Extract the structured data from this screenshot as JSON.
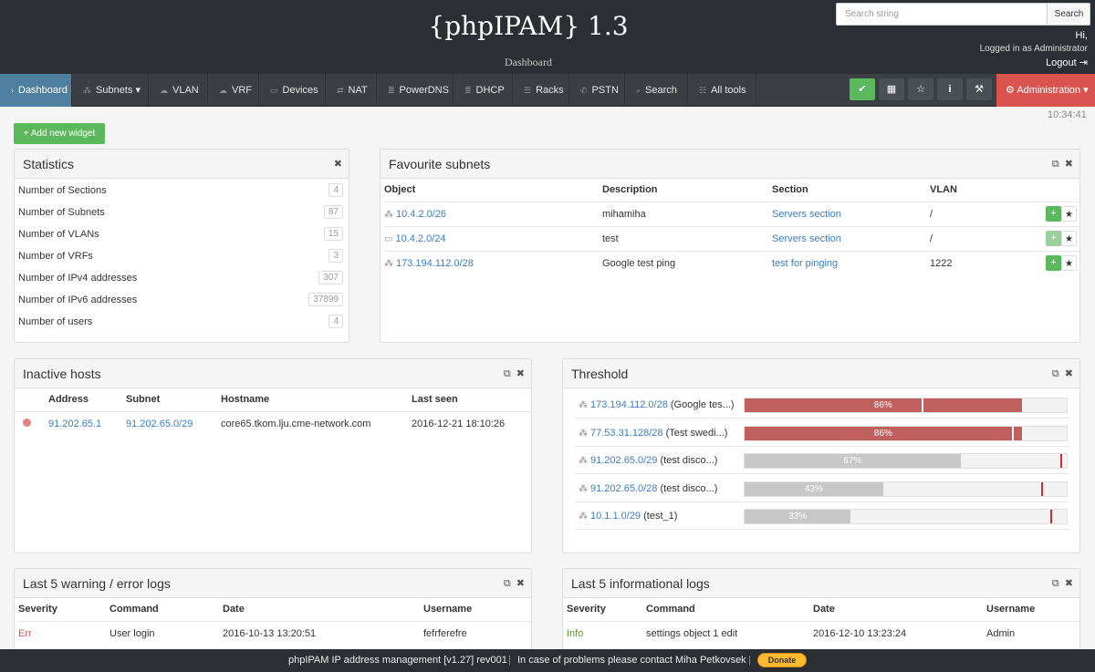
{
  "header": {
    "brand": "{phpIPAM} 1.3",
    "subtitle": "Dashboard",
    "search_placeholder": "Search string",
    "search_button": "Search",
    "greeting": "Hi,",
    "logged_in": "Logged in as Administrator",
    "logout": "Logout"
  },
  "nav": {
    "items": [
      {
        "label": "Dashboard",
        "icon": "chevron-right-icon"
      },
      {
        "label": "Subnets",
        "icon": "sitemap-icon"
      },
      {
        "label": "VLAN",
        "icon": "cloud-icon"
      },
      {
        "label": "VRF",
        "icon": "cloud-icon"
      },
      {
        "label": "Devices",
        "icon": "desktop-icon"
      },
      {
        "label": "NAT",
        "icon": "exchange-icon"
      },
      {
        "label": "PowerDNS",
        "icon": "database-icon"
      },
      {
        "label": "DHCP",
        "icon": "database-icon"
      },
      {
        "label": "Racks",
        "icon": "bars-icon"
      },
      {
        "label": "PSTN",
        "icon": "phone-icon"
      },
      {
        "label": "Search",
        "icon": "search-icon"
      },
      {
        "label": "All tools",
        "icon": "list-icon"
      }
    ],
    "admin_label": "Administration"
  },
  "clock": "10:34:41",
  "add_widget": "+ Add new widget",
  "statistics": {
    "title": "Statistics",
    "rows": [
      {
        "label": "Number of Sections",
        "value": "4"
      },
      {
        "label": "Number of Subnets",
        "value": "87"
      },
      {
        "label": "Number of VLANs",
        "value": "15"
      },
      {
        "label": "Number of VRFs",
        "value": "3"
      },
      {
        "label": "Number of IPv4 addresses",
        "value": "307"
      },
      {
        "label": "Number of IPv6 addresses",
        "value": "37899"
      },
      {
        "label": "Number of users",
        "value": "4"
      }
    ]
  },
  "favourites": {
    "title": "Favourite subnets",
    "columns": [
      "Object",
      "Description",
      "Section",
      "VLAN"
    ],
    "rows": [
      {
        "object": "10.4.2.0/26",
        "description": "mihamiha",
        "section": "Servers section",
        "vlan": "/"
      },
      {
        "object": "10.4.2.0/24",
        "description": "test",
        "section": "Servers section",
        "vlan": "/"
      },
      {
        "object": "173.194.112.0/28",
        "description": "Google test ping",
        "section": "test for pinging",
        "vlan": "1222"
      }
    ]
  },
  "inactive": {
    "title": "Inactive hosts",
    "columns": [
      "Address",
      "Subnet",
      "Hostname",
      "Last seen"
    ],
    "rows": [
      {
        "address": "91.202.65.1",
        "subnet": "91.202.65.0/29",
        "hostname": "core65.tkom.lju.cme-network.com",
        "last_seen": "2016-12-21 18:10:26"
      }
    ]
  },
  "threshold": {
    "title": "Threshold",
    "rows": [
      {
        "subnet": "173.194.112.0/28",
        "desc": "(Google tes...)",
        "pct": 86,
        "label": "86%",
        "mark": 55,
        "over": true
      },
      {
        "subnet": "77.53.31.128/28",
        "desc": "(Test swedi...)",
        "pct": 86,
        "label": "86%",
        "mark": 83,
        "over": true
      },
      {
        "subnet": "91.202.65.0/29",
        "desc": "(test disco...)",
        "pct": 67,
        "label": "67%",
        "mark": 98,
        "over": false
      },
      {
        "subnet": "91.202.65.0/28",
        "desc": "(test disco...)",
        "pct": 43,
        "label": "43%",
        "mark": 92,
        "over": false
      },
      {
        "subnet": "10.1.1.0/29",
        "desc": "(test_1)",
        "pct": 33,
        "label": "33%",
        "mark": 95,
        "over": false
      }
    ]
  },
  "warn_logs": {
    "title": "Last 5 warning / error logs",
    "columns": [
      "Severity",
      "Command",
      "Date",
      "Username"
    ],
    "rows": [
      {
        "severity": "Err",
        "command": "User login",
        "date": "2016-10-13 13:20:51",
        "username": "fefrferefre"
      }
    ]
  },
  "info_logs": {
    "title": "Last 5 informational logs",
    "columns": [
      "Severity",
      "Command",
      "Date",
      "Username"
    ],
    "rows": [
      {
        "severity": "Info",
        "command": "settings object 1 edit",
        "date": "2016-12-10 13:23:24",
        "username": "Admin"
      }
    ]
  },
  "footer": {
    "left": "phpIPAM IP address management [v1.27] rev001",
    "middle": "In case of problems please contact Miha Petkovsek",
    "donate": "Donate"
  },
  "colors": {
    "over_threshold": "#c0605e",
    "under_threshold": "#c8c8c8",
    "admin": "#d9534f",
    "success": "#5cb85c",
    "link": "#3a7dc0",
    "error": "#d9534f",
    "info": "#5a9a2a"
  }
}
